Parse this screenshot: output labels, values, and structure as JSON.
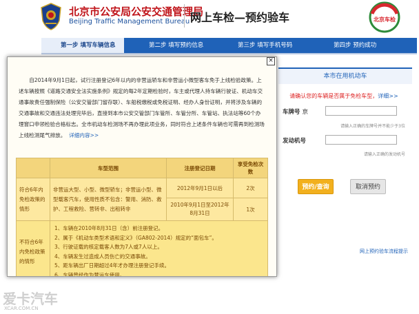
{
  "header": {
    "org_name": "北京市公安局公安交通管理局",
    "org_name_en": "Beijing Traffic Management Bureau",
    "service_title": "网上车检—预约验车",
    "brand_logo_text": "北京车检"
  },
  "steps": [
    {
      "label": "第一步  填写车辆信息",
      "active": true
    },
    {
      "label": "第二步  填写预约信息",
      "active": false
    },
    {
      "label": "第三步  填写手机号码",
      "active": false
    },
    {
      "label": "第四步  预约成功",
      "active": false
    }
  ],
  "side_panel": {
    "title": "本市在用机动车",
    "hint": "请确认您的车辆是否属于免检车型，",
    "hint_link": "详细>>",
    "plate_label": "车牌号",
    "plate_prefix": "京",
    "plate_note": "请输入正确的车牌号并不能少于3位",
    "engine_label": "发动机号",
    "engine_note": "请输入正确的发动机号",
    "query_button": "预约/查询",
    "cancel_button": "取消预约",
    "flow_link": "网上预约验车流程提示"
  },
  "modal": {
    "close_label": "×",
    "intro": "自2014年9月1日起，试行注册登记6年以内的非营运轿车和非营运小微型客车免于上线检验政策。上述车辆按照《道路交通安全法实施条例》规定的每2年定期检验时，车主或代理人持车辆行驶证、机动车交通事故责任强制保险（公安交管部门留存联）、车船税缴税或免税证明、经办人身份证明，并将涉及车辆的交通事故和交通违法处理完毕后，直接到本市公安交管部门车管所、车管分所、车管站、执法站等60个办理窗口申领检验合格标志。全市机动车检测场不再办理此项业务，同时符合上述条件车辆也可需再到检测场上线检测尾气排放。",
    "intro_link": "详细内容>>",
    "table": {
      "headers": [
        "",
        "车型范围",
        "注册登记日期",
        "享受免检次数"
      ],
      "section1": {
        "category": "符合6年内免检政策的情形",
        "scope": "非营运大型、小型、微型轿车；非营运小型、微型载客汽车，使用性质不包含：警用、消防、救护、工程救险、营转非、出租转非",
        "rows": [
          {
            "date": "2012年9月1日以后",
            "times": "2次"
          },
          {
            "date": "2010年9月1日至2012年8月31日",
            "times": "1次"
          }
        ]
      },
      "section2": {
        "category": "不符合6年内免检政策的情形",
        "items": [
          "1、车辆在2010年8月31日（含）前注册登记。",
          "2、属于《机动车类型术语和定义》（GA802-2014）规定的“面包车”。",
          "3、行驶证载的核定载客人数为7人或7人以上。",
          "4、车辆发生过造成人员伤亡的交通事故。",
          "5、距车辆出厂日期超过4年才办理注册登记手续。",
          "6、车辆曾经作为营运车使用。"
        ]
      }
    }
  },
  "watermark": {
    "text": "爱卡汽车",
    "url": "XCAR.COM.CN"
  },
  "colors": {
    "primary_blue": "#1f62b8",
    "org_red": "#c0151b",
    "query_orange": "#f2b01e",
    "table_yellow": "#fde8a0"
  }
}
